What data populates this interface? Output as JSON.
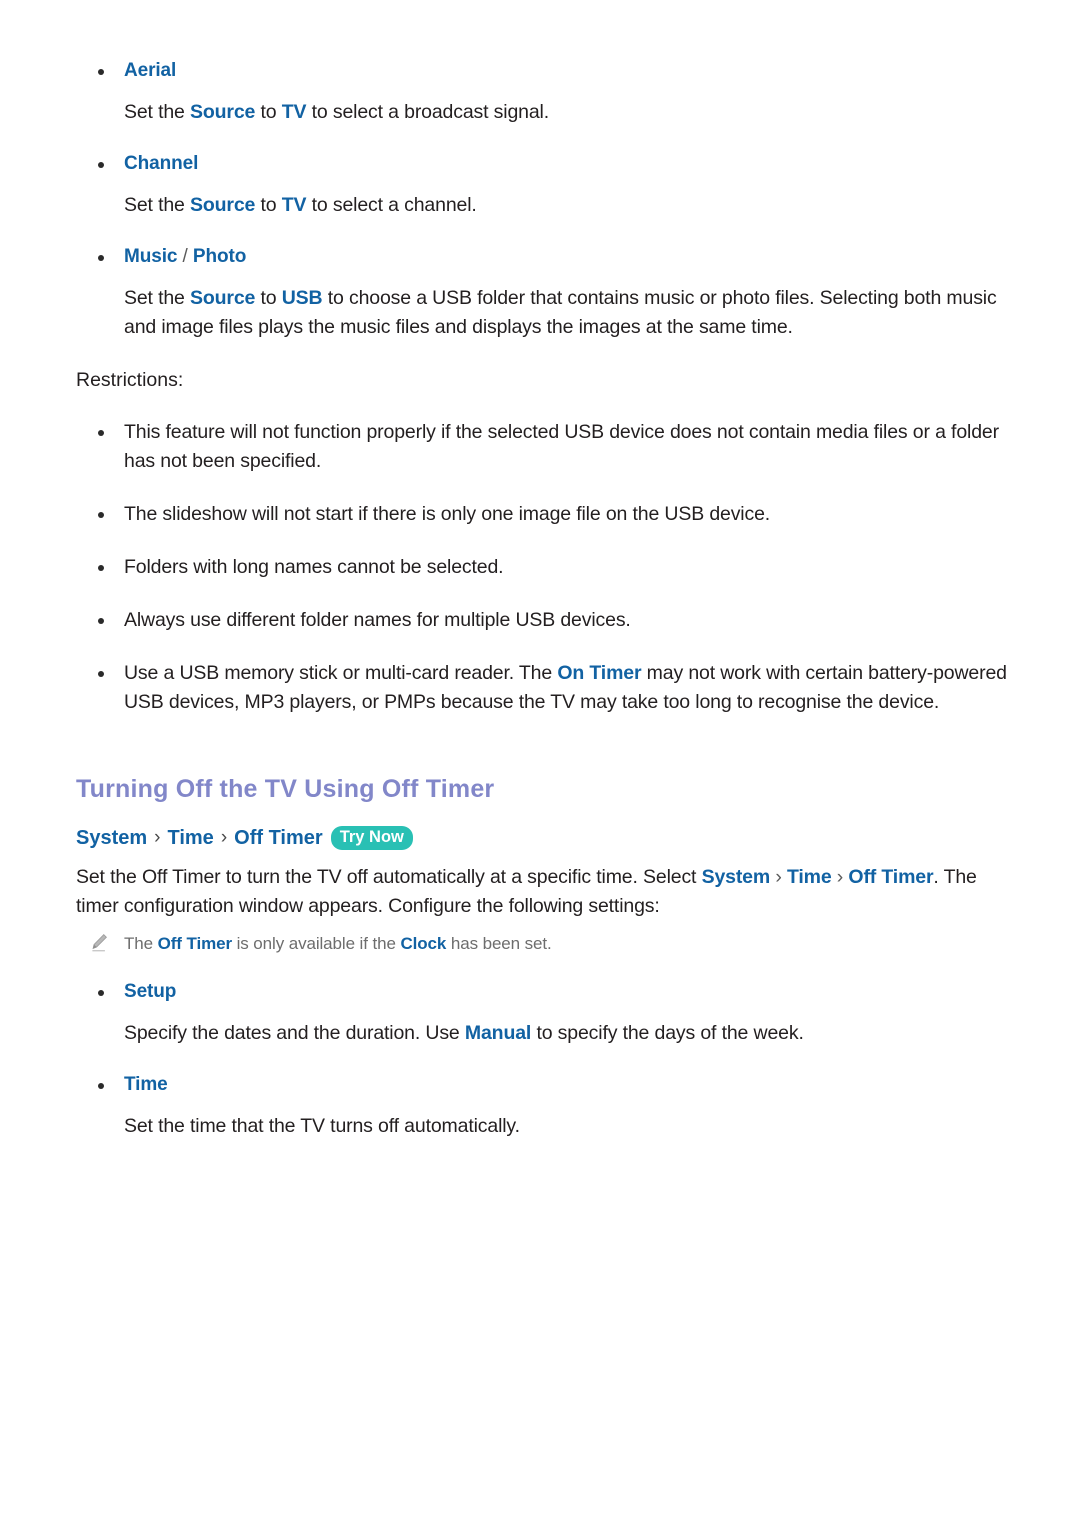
{
  "top_list": [
    {
      "term": "Aerial",
      "desc_parts": [
        {
          "t": "Set the ",
          "s": "plain"
        },
        {
          "t": "Source",
          "s": "link"
        },
        {
          "t": " to ",
          "s": "plain"
        },
        {
          "t": "TV",
          "s": "link"
        },
        {
          "t": " to select a broadcast signal.",
          "s": "plain"
        }
      ]
    },
    {
      "term": "Channel",
      "desc_parts": [
        {
          "t": "Set the ",
          "s": "plain"
        },
        {
          "t": "Source",
          "s": "link"
        },
        {
          "t": " to ",
          "s": "plain"
        },
        {
          "t": "TV",
          "s": "link"
        },
        {
          "t": " to select a channel.",
          "s": "plain"
        }
      ]
    }
  ],
  "music_photo": {
    "term_music": "Music",
    "term_slash": " / ",
    "term_photo": "Photo",
    "desc_parts": [
      {
        "t": "Set the ",
        "s": "plain"
      },
      {
        "t": "Source",
        "s": "link"
      },
      {
        "t": " to ",
        "s": "plain"
      },
      {
        "t": "USB",
        "s": "link"
      },
      {
        "t": " to choose a USB folder that contains music or photo files. Selecting both music and image files plays the music files and displays the images at the same time.",
        "s": "plain"
      }
    ]
  },
  "restrictions": {
    "label": "Restrictions:",
    "items": [
      [
        {
          "t": "This feature will not function properly if the selected USB device does not contain media files or a folder has not been specified.",
          "s": "plain"
        }
      ],
      [
        {
          "t": "The slideshow will not start if there is only one image file on the USB device.",
          "s": "plain"
        }
      ],
      [
        {
          "t": "Folders with long names cannot be selected.",
          "s": "plain"
        }
      ],
      [
        {
          "t": "Always use different folder names for multiple USB devices.",
          "s": "plain"
        }
      ],
      [
        {
          "t": "Use a USB memory stick or multi-card reader. The ",
          "s": "plain"
        },
        {
          "t": "On Timer",
          "s": "link"
        },
        {
          "t": " may not work with certain battery-powered USB devices, MP3 players, or PMPs because the TV may take too long to recognise the device.",
          "s": "plain"
        }
      ]
    ]
  },
  "section": {
    "heading": "Turning Off the TV Using Off Timer",
    "breadcrumb": {
      "crumbs": [
        "System",
        "Time",
        "Off Timer"
      ],
      "separator": "›",
      "badge": "Try Now"
    },
    "intro_parts": [
      {
        "t": "Set the Off Timer to turn the TV off automatically at a specific time. Select ",
        "s": "plain"
      },
      {
        "t": "System",
        "s": "link"
      },
      {
        "t": " › ",
        "s": "sep"
      },
      {
        "t": "Time",
        "s": "link"
      },
      {
        "t": " › ",
        "s": "sep"
      },
      {
        "t": "Off Timer",
        "s": "link"
      },
      {
        "t": ". The timer configuration window appears. Configure the following settings:",
        "s": "plain"
      }
    ],
    "note_parts": [
      {
        "t": "The ",
        "s": "plain"
      },
      {
        "t": "Off Timer",
        "s": "link"
      },
      {
        "t": " is only available if the ",
        "s": "plain"
      },
      {
        "t": "Clock",
        "s": "link"
      },
      {
        "t": " has been set.",
        "s": "plain"
      }
    ],
    "settings_list": [
      {
        "term": "Setup",
        "desc_parts": [
          {
            "t": "Specify the dates and the duration. Use ",
            "s": "plain"
          },
          {
            "t": "Manual",
            "s": "link"
          },
          {
            "t": " to specify the days of the week.",
            "s": "plain"
          }
        ]
      },
      {
        "term": "Time",
        "desc_parts": [
          {
            "t": "Set the time that the TV turns off automatically.",
            "s": "plain"
          }
        ]
      }
    ]
  },
  "colors": {
    "link_blue": "#1262a3",
    "heading_purple": "#8287c9",
    "badge_teal": "#29c0b4",
    "body_black": "#231f20",
    "note_gray": "#6d6d6d"
  }
}
